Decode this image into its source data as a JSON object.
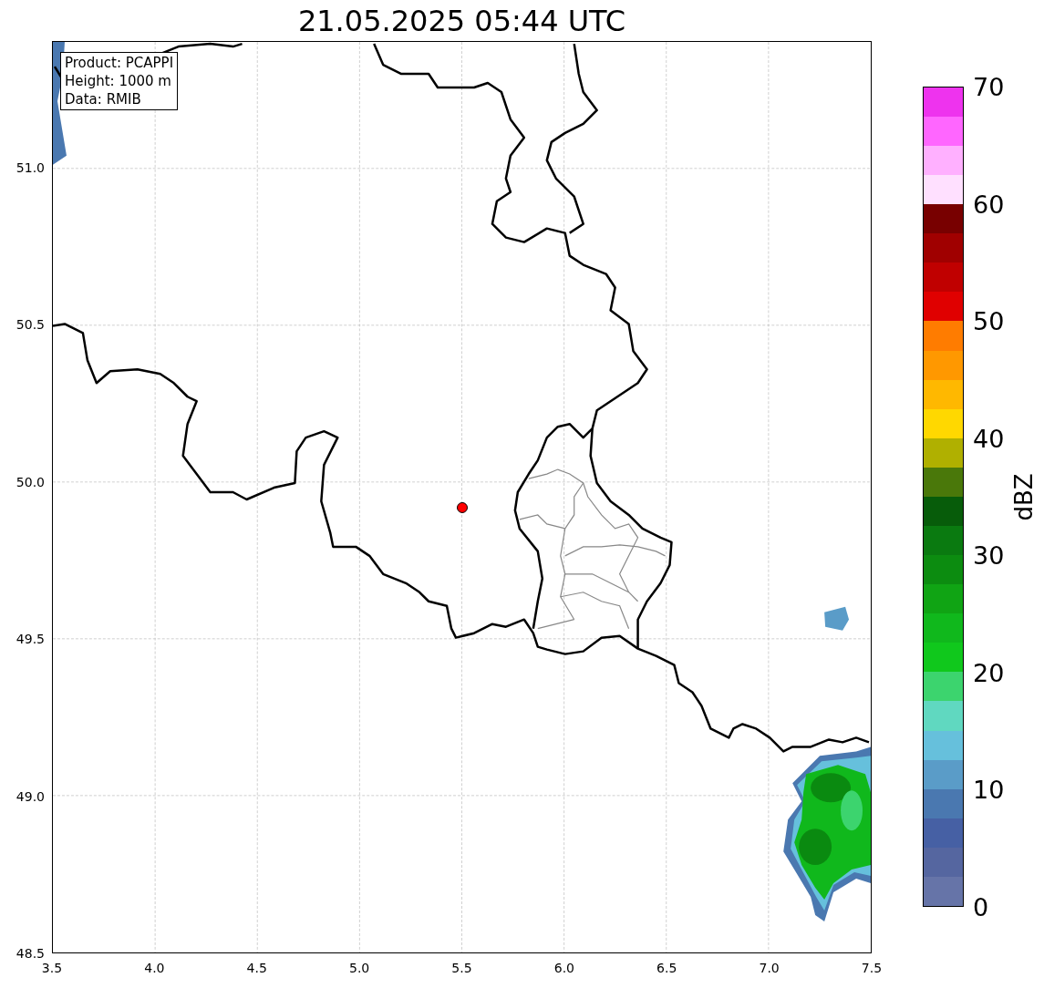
{
  "title": "21.05.2025 05:44 UTC",
  "info_box": [
    "Product: PCAPPI",
    "Height: 1000 m",
    "Data: RMIB"
  ],
  "map": {
    "xticks": [
      "3.5",
      "4.0",
      "4.5",
      "5.0",
      "5.5",
      "6.0",
      "6.5",
      "7.0",
      "7.5"
    ],
    "yticks": [
      "51.0",
      "50.5",
      "50.0",
      "49.5",
      "49.0",
      "48.5"
    ]
  },
  "colorbar": {
    "label": "dBZ",
    "ticks": [
      "70",
      "60",
      "50",
      "40",
      "30",
      "20",
      "10",
      "0"
    ],
    "bins": [
      {
        "color": "#6674a8"
      },
      {
        "color": "#5566a0"
      },
      {
        "color": "#4660a4"
      },
      {
        "color": "#4a78b0"
      },
      {
        "color": "#5a9cc8"
      },
      {
        "color": "#66c0dc"
      },
      {
        "color": "#60d8c0"
      },
      {
        "color": "#3cd46e"
      },
      {
        "color": "#10c81c"
      },
      {
        "color": "#10b81c"
      },
      {
        "color": "#10a414"
      },
      {
        "color": "#0c8c10"
      },
      {
        "color": "#0a7a10"
      },
      {
        "color": "#075c0a"
      },
      {
        "color": "#4a780a"
      },
      {
        "color": "#b0b000"
      },
      {
        "color": "#ffd800"
      },
      {
        "color": "#ffb800"
      },
      {
        "color": "#ff9800"
      },
      {
        "color": "#ff7c00"
      },
      {
        "color": "#e00000"
      },
      {
        "color": "#c00000"
      },
      {
        "color": "#a00000"
      },
      {
        "color": "#780000"
      },
      {
        "color": "#ffe0ff"
      },
      {
        "color": "#ffb0ff"
      },
      {
        "color": "#ff66ff"
      },
      {
        "color": "#ee33ee"
      }
    ]
  }
}
